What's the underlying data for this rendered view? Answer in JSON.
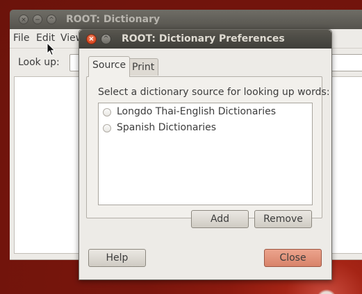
{
  "main_window": {
    "title": "ROOT: Dictionary",
    "menu": [
      "File",
      "Edit",
      "View"
    ],
    "lookup_label": "Look up:",
    "lookup_value": ""
  },
  "dialog": {
    "title": "ROOT: Dictionary Preferences",
    "tabs": [
      {
        "label": "Source",
        "active": true
      },
      {
        "label": "Print",
        "active": false
      }
    ],
    "heading": "Select a dictionary source for looking up words:",
    "sources": [
      {
        "label": "Longdo Thai-English Dictionaries",
        "selected": false
      },
      {
        "label": "Spanish Dictionaries",
        "selected": false
      }
    ],
    "buttons": {
      "add": "Add",
      "remove": "Remove",
      "help": "Help",
      "close": "Close"
    }
  },
  "colors": {
    "close_button_accent": "#d9451f",
    "desktop": "#8c1a0f"
  }
}
